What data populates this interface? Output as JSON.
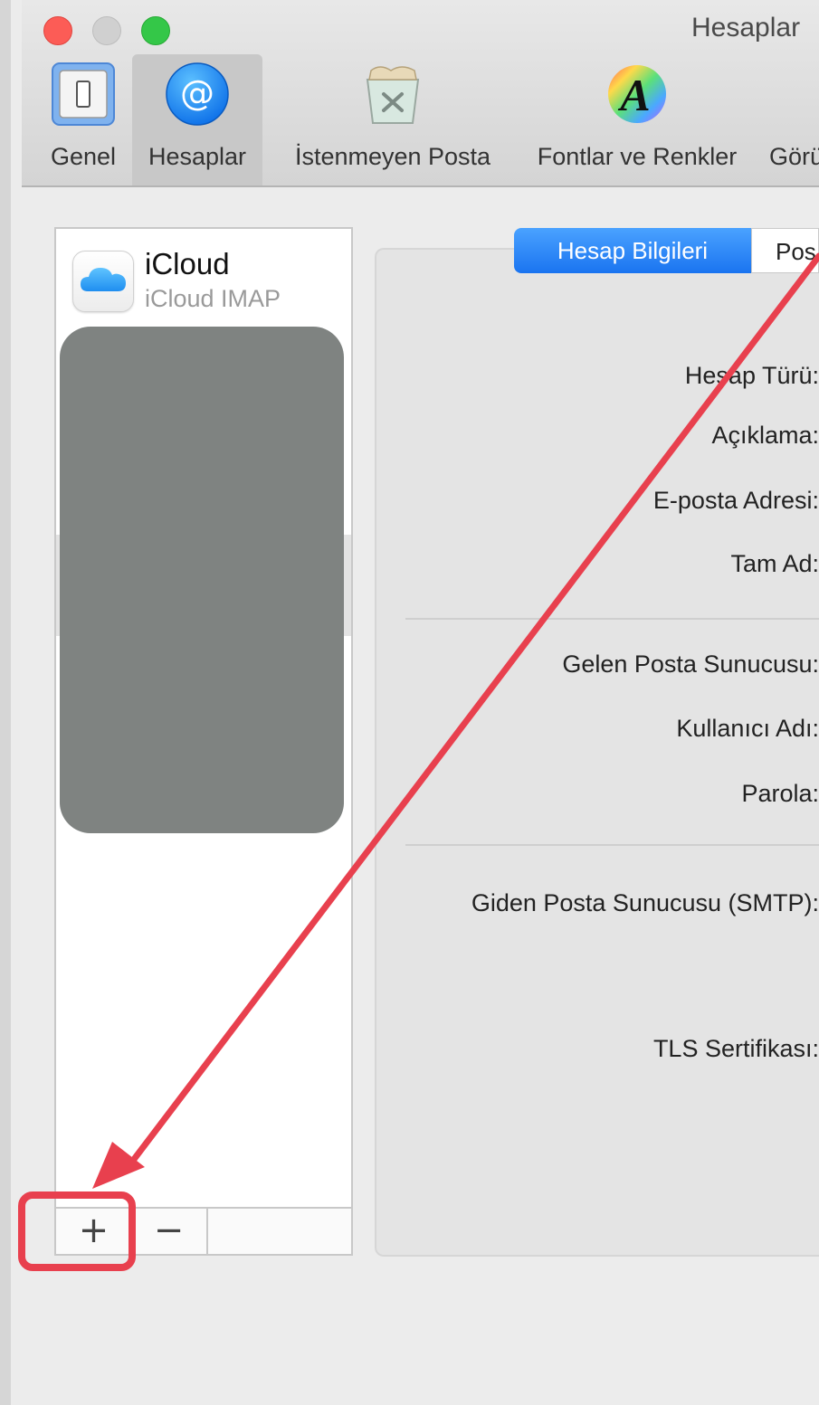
{
  "window": {
    "title": "Hesaplar"
  },
  "toolbar": {
    "items": [
      {
        "label": "Genel",
        "icon": "switch-icon"
      },
      {
        "label": "Hesaplar",
        "icon": "at-sign-icon"
      },
      {
        "label": "İstenmeyen Posta",
        "icon": "junk-trash-icon"
      },
      {
        "label": "Fontlar ve Renkler",
        "icon": "font-color-icon"
      },
      {
        "label": "Görü",
        "icon": "viewing-icon"
      }
    ]
  },
  "accounts": {
    "items": [
      {
        "name": "iCloud",
        "type": "iCloud IMAP",
        "icon": "icloud-icon"
      }
    ],
    "add_button": "+",
    "remove_button": "−"
  },
  "details": {
    "tabs": [
      {
        "label": "Hesap Bilgileri",
        "active": true
      },
      {
        "label": "Pos",
        "active": false
      }
    ],
    "fields": {
      "account_type": "Hesap Türü:",
      "description": "Açıklama:",
      "email": "E-posta Adresi:",
      "full_name": "Tam Ad:",
      "incoming_server": "Gelen Posta Sunucusu:",
      "username": "Kullanıcı Adı:",
      "password": "Parola:",
      "outgoing_server": "Giden Posta Sunucusu (SMTP):",
      "tls_certificate": "TLS Sertifikası:"
    }
  },
  "colors": {
    "annotation": "#e8404e",
    "accent": "#1a74f0",
    "redaction": "#7f8381"
  }
}
